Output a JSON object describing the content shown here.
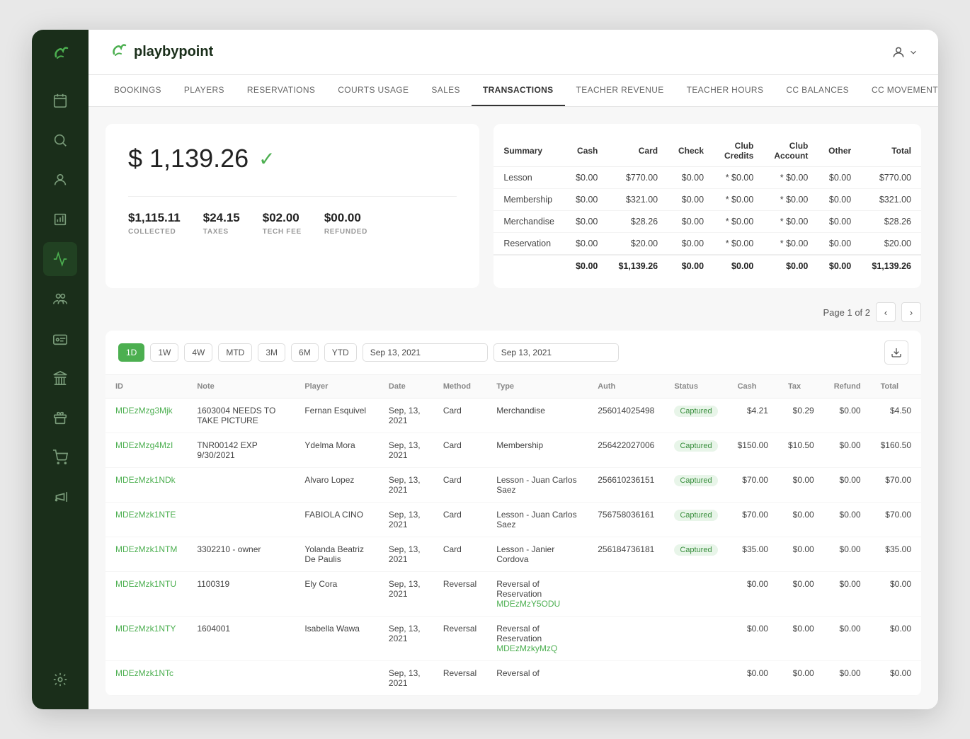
{
  "app": {
    "name": "playbypoint",
    "logo_symbol": "🍃"
  },
  "header": {
    "user_icon": "👤"
  },
  "nav": {
    "tabs": [
      {
        "id": "bookings",
        "label": "BOOKINGS",
        "active": false
      },
      {
        "id": "players",
        "label": "PLAYERS",
        "active": false
      },
      {
        "id": "reservations",
        "label": "RESERVATIONS",
        "active": false
      },
      {
        "id": "courts-usage",
        "label": "COURTS USAGE",
        "active": false
      },
      {
        "id": "sales",
        "label": "SALES",
        "active": false
      },
      {
        "id": "transactions",
        "label": "TRANSACTIONS",
        "active": true
      },
      {
        "id": "teacher-revenue",
        "label": "TEACHER REVENUE",
        "active": false
      },
      {
        "id": "teacher-hours",
        "label": "TEACHER HOURS",
        "active": false
      },
      {
        "id": "cc-balances",
        "label": "CC BALANCES",
        "active": false
      },
      {
        "id": "cc-movements",
        "label": "CC MOVEMENTS",
        "active": false
      }
    ]
  },
  "sidebar": {
    "items": [
      {
        "id": "calendar",
        "icon": "calendar"
      },
      {
        "id": "search",
        "icon": "search"
      },
      {
        "id": "user-admin",
        "icon": "user-admin"
      },
      {
        "id": "reports",
        "icon": "reports"
      },
      {
        "id": "analytics",
        "icon": "analytics",
        "active": true
      },
      {
        "id": "team",
        "icon": "team"
      },
      {
        "id": "id-card",
        "icon": "id-card"
      },
      {
        "id": "bank",
        "icon": "bank"
      },
      {
        "id": "gift",
        "icon": "gift"
      },
      {
        "id": "cart",
        "icon": "cart"
      },
      {
        "id": "megaphone",
        "icon": "megaphone"
      }
    ],
    "bottom": [
      {
        "id": "settings",
        "icon": "settings"
      }
    ]
  },
  "summary_card": {
    "total_amount": "$ 1,139.26",
    "collected_label": "COLLECTED",
    "collected_value": "$1,115.11",
    "taxes_label": "TAXES",
    "taxes_value": "$24.15",
    "tech_fee_label": "TECH FEE",
    "tech_fee_value": "$02.00",
    "refunded_label": "REFUNDED",
    "refunded_value": "$00.00"
  },
  "summary_table": {
    "headers": [
      "Summary",
      "Cash",
      "Card",
      "Check",
      "Club Credits",
      "Club Account",
      "Other",
      "Total"
    ],
    "rows": [
      {
        "label": "Lesson",
        "cash": "$0.00",
        "card": "$770.00",
        "check": "$0.00",
        "club_credits": "* $0.00",
        "club_account": "* $0.00",
        "other": "$0.00",
        "total": "$770.00"
      },
      {
        "label": "Membership",
        "cash": "$0.00",
        "card": "$321.00",
        "check": "$0.00",
        "club_credits": "* $0.00",
        "club_account": "* $0.00",
        "other": "$0.00",
        "total": "$321.00"
      },
      {
        "label": "Merchandise",
        "cash": "$0.00",
        "card": "$28.26",
        "check": "$0.00",
        "club_credits": "* $0.00",
        "club_account": "* $0.00",
        "other": "$0.00",
        "total": "$28.26"
      },
      {
        "label": "Reservation",
        "cash": "$0.00",
        "card": "$20.00",
        "check": "$0.00",
        "club_credits": "* $0.00",
        "club_account": "* $0.00",
        "other": "$0.00",
        "total": "$20.00"
      },
      {
        "label": "",
        "cash": "$0.00",
        "card": "$1,139.26",
        "check": "$0.00",
        "club_credits": "$0.00",
        "club_account": "$0.00",
        "other": "$0.00",
        "total": "$1,139.26"
      }
    ]
  },
  "pagination": {
    "text": "Page 1 of 2"
  },
  "toolbar": {
    "time_buttons": [
      "1D",
      "1W",
      "4W",
      "MTD",
      "3M",
      "6M",
      "YTD"
    ],
    "active_time": "1D",
    "date_from": "Sep 13, 2021",
    "date_to": "Sep 13, 2021"
  },
  "transactions": {
    "columns": [
      "ID",
      "Note",
      "Player",
      "Date",
      "Method",
      "Type",
      "Auth",
      "Status",
      "Cash",
      "Tax",
      "Refund",
      "Total"
    ],
    "rows": [
      {
        "id": "MDEzMzg3Mjk",
        "note": "1603004 NEEDS TO TAKE PICTURE",
        "player": "Fernan Esquivel",
        "date": "Sep, 13, 2021",
        "method": "Card",
        "type": "Merchandise",
        "auth": "256014025498",
        "status": "Captured",
        "cash": "$4.21",
        "tax": "$0.29",
        "refund": "$0.00",
        "total": "$4.50"
      },
      {
        "id": "MDEzMzg4MzI",
        "note": "TNR00142 EXP 9/30/2021",
        "player": "Ydelma Mora",
        "date": "Sep, 13, 2021",
        "method": "Card",
        "type": "Membership",
        "auth": "256422027006",
        "status": "Captured",
        "cash": "$150.00",
        "tax": "$10.50",
        "refund": "$0.00",
        "total": "$160.50"
      },
      {
        "id": "MDEzMzk1NDk",
        "note": "",
        "player": "Alvaro Lopez",
        "date": "Sep, 13, 2021",
        "method": "Card",
        "type": "Lesson - Juan Carlos Saez",
        "auth": "256610236151",
        "status": "Captured",
        "cash": "$70.00",
        "tax": "$0.00",
        "refund": "$0.00",
        "total": "$70.00"
      },
      {
        "id": "MDEzMzk1NTE",
        "note": "",
        "player": "FABIOLA CINO",
        "date": "Sep, 13, 2021",
        "method": "Card",
        "type": "Lesson - Juan Carlos Saez",
        "auth": "756758036161",
        "status": "Captured",
        "cash": "$70.00",
        "tax": "$0.00",
        "refund": "$0.00",
        "total": "$70.00"
      },
      {
        "id": "MDEzMzk1NTM",
        "note": "3302210 - owner",
        "player": "Yolanda Beatriz De Paulis",
        "date": "Sep, 13, 2021",
        "method": "Card",
        "type": "Lesson - Janier Cordova",
        "auth": "256184736181",
        "status": "Captured",
        "cash": "$35.00",
        "tax": "$0.00",
        "refund": "$0.00",
        "total": "$35.00"
      },
      {
        "id": "MDEzMzk1NTU",
        "note": "1100319",
        "player": "Ely Cora",
        "date": "Sep, 13, 2021",
        "method": "Reversal",
        "type": "Reversal of Reservation",
        "type_link": "MDEzMzY5ODU",
        "auth": "",
        "status": "",
        "cash": "$0.00",
        "tax": "$0.00",
        "refund": "$0.00",
        "total": "$0.00"
      },
      {
        "id": "MDEzMzk1NTY",
        "note": "1604001",
        "player": "Isabella Wawa",
        "date": "Sep, 13, 2021",
        "method": "Reversal",
        "type": "Reversal of Reservation",
        "type_link": "MDEzMzkyMzQ",
        "auth": "",
        "status": "",
        "cash": "$0.00",
        "tax": "$0.00",
        "refund": "$0.00",
        "total": "$0.00"
      },
      {
        "id": "MDEzMzk1NTc",
        "note": "",
        "player": "",
        "date": "Sep, 13, 2021",
        "method": "Reversal",
        "type": "Reversal of",
        "type_link": "",
        "auth": "",
        "status": "",
        "cash": "$0.00",
        "tax": "$0.00",
        "refund": "$0.00",
        "total": "$0.00"
      }
    ]
  }
}
